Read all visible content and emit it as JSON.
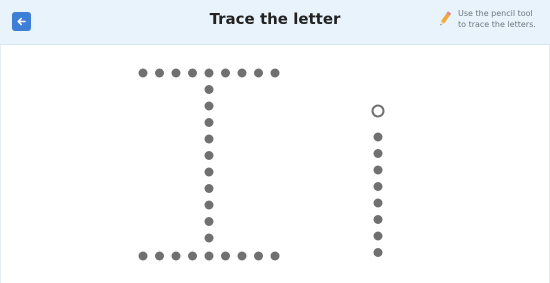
{
  "header": {
    "title": "Trace the letter",
    "back_icon": "arrow-left-icon",
    "hint_icon": "pencil-icon",
    "hint_line1": "Use the pencil tool",
    "hint_line2": "to trace the letters."
  },
  "trace": {
    "uppercase_letter": "I",
    "lowercase_letter": "i",
    "start_dot": "hollow circle",
    "dot_color": "#707070",
    "accent_color": "#3d7ed6",
    "header_color": "#e8f3fb"
  }
}
